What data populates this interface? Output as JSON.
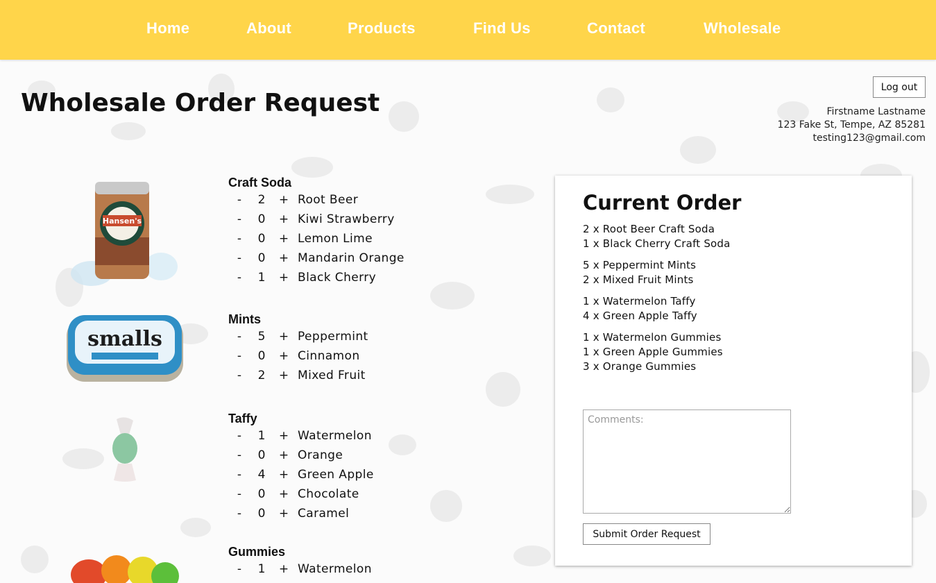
{
  "nav": {
    "items": [
      "Home",
      "About",
      "Products",
      "Find Us",
      "Contact",
      "Wholesale"
    ]
  },
  "page": {
    "title": "Wholesale Order Request",
    "logout_label": "Log out"
  },
  "user": {
    "name": "Firstname Lastname",
    "address": "123 Fake St, Tempe, AZ 85281",
    "email": "testing123@gmail.com"
  },
  "product_images": {
    "craft_soda": "Hansen's soda can",
    "mints": "Altoids smalls tin",
    "taffy": "Green taffy piece",
    "gummies": "Gummy bears"
  },
  "catalog": [
    {
      "category": "Craft Soda",
      "items": [
        {
          "qty": "2",
          "name": "Root Beer"
        },
        {
          "qty": "0",
          "name": "Kiwi Strawberry"
        },
        {
          "qty": "0",
          "name": "Lemon Lime"
        },
        {
          "qty": "0",
          "name": "Mandarin Orange"
        },
        {
          "qty": "1",
          "name": "Black Cherry"
        }
      ]
    },
    {
      "category": "Mints",
      "items": [
        {
          "qty": "5",
          "name": "Peppermint"
        },
        {
          "qty": "0",
          "name": "Cinnamon"
        },
        {
          "qty": "2",
          "name": "Mixed Fruit"
        }
      ]
    },
    {
      "category": "Taffy",
      "items": [
        {
          "qty": "1",
          "name": "Watermelon"
        },
        {
          "qty": "0",
          "name": "Orange"
        },
        {
          "qty": "4",
          "name": "Green Apple"
        },
        {
          "qty": "0",
          "name": "Chocolate"
        },
        {
          "qty": "0",
          "name": "Caramel"
        }
      ]
    },
    {
      "category": "Gummies",
      "items": [
        {
          "qty": "1",
          "name": "Watermelon"
        }
      ]
    }
  ],
  "controls": {
    "minus": "-",
    "plus": "+"
  },
  "order": {
    "title": "Current Order",
    "groups": [
      [
        "2 x Root Beer Craft Soda",
        "1 x Black Cherry Craft Soda"
      ],
      [
        "5 x Peppermint Mints",
        "2 x Mixed Fruit Mints"
      ],
      [
        "1 x Watermelon Taffy",
        "4 x Green Apple Taffy"
      ],
      [
        "1 x Watermelon Gummies",
        "1 x Green Apple Gummies",
        "3 x Orange Gummies"
      ]
    ],
    "comments_placeholder": "Comments:",
    "submit_label": "Submit Order Request"
  },
  "colors": {
    "nav_bg": "#ffd54a",
    "nav_text": "#ffffff"
  }
}
